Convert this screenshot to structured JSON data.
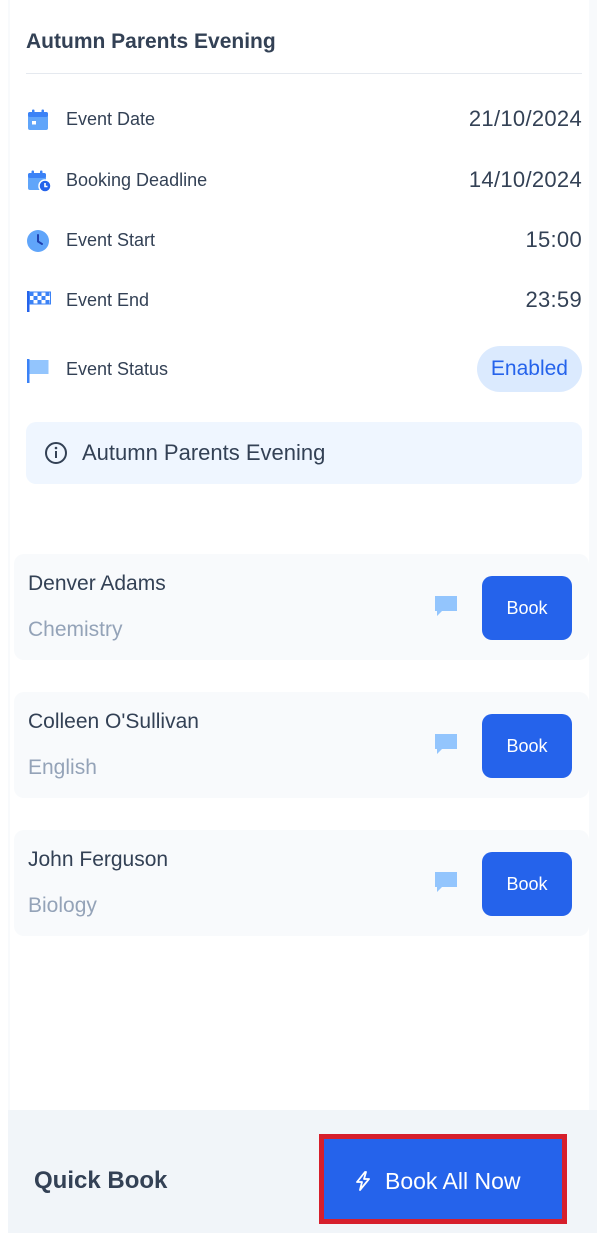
{
  "event": {
    "title": "Autumn Parents Evening",
    "fields": [
      {
        "label": "Event Date",
        "value": "21/10/2024",
        "icon": "calendar-icon"
      },
      {
        "label": "Booking Deadline",
        "value": "14/10/2024",
        "icon": "calendar-clock-icon"
      },
      {
        "label": "Event Start",
        "value": "15:00",
        "icon": "clock-icon"
      },
      {
        "label": "Event End",
        "value": "23:59",
        "icon": "checkered-flag-icon"
      },
      {
        "label": "Event Status",
        "value": "Enabled",
        "icon": "flag-icon"
      }
    ],
    "info_text": "Autumn Parents Evening",
    "info_icon": "info-icon"
  },
  "teachers": [
    {
      "name": "Denver Adams",
      "subject": "Chemistry",
      "book_label": "Book",
      "message_icon": "message-icon"
    },
    {
      "name": "Colleen O'Sullivan",
      "subject": "English",
      "book_label": "Book",
      "message_icon": "message-icon"
    },
    {
      "name": "John Ferguson",
      "subject": "Biology",
      "book_label": "Book",
      "message_icon": "message-icon"
    }
  ],
  "quick_book": {
    "label": "Quick Book",
    "button_label": "Book All Now",
    "button_icon": "lightning-icon"
  },
  "colors": {
    "primary": "#2563eb",
    "status_bg": "#dbeafe",
    "icon_blue": "#60a5fa",
    "highlight_border": "#d61f2c"
  }
}
